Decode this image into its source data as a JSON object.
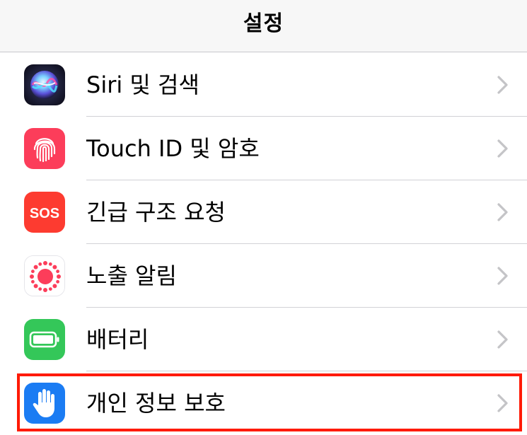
{
  "nav": {
    "title": "설정"
  },
  "rows": [
    {
      "label": "Siri 및 검색",
      "icon": "siri-icon",
      "icon_color": "#1a1a2e"
    },
    {
      "label": "Touch ID 및 암호",
      "icon": "fingerprint-icon",
      "icon_color": "#fc3d5a"
    },
    {
      "label": "긴급 구조 요청",
      "icon_text": "SOS",
      "icon": "sos-icon",
      "icon_color": "#fd3b30"
    },
    {
      "label": "노출 알림",
      "icon": "exposure-icon",
      "icon_color": "#ffffff"
    },
    {
      "label": "배터리",
      "icon": "battery-icon",
      "icon_color": "#34c759"
    },
    {
      "label": "개인 정보 보호",
      "icon": "hand-icon",
      "icon_color": "#1b7cf3"
    }
  ],
  "highlight_color": "#ff1a05"
}
